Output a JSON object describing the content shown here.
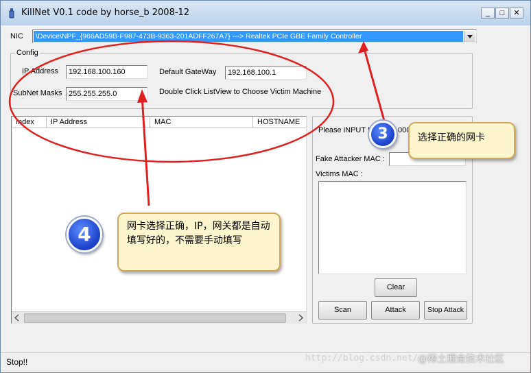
{
  "window": {
    "title": "KillNet  V0.1 code by horse_b 2008-12",
    "minimize_glyph": "_",
    "maximize_glyph": "□",
    "close_glyph": "✕"
  },
  "nic": {
    "label": "NIC",
    "selected": "\\Device\\NPF_{966AD59B-F987-473B-9363-201ADFF267A7}  --->  Realtek PCIe GBE Family Controller"
  },
  "config": {
    "title": "Config",
    "ip_label": "IP Address",
    "ip_value": "192.168.100.160",
    "gateway_label": "Default GateWay",
    "gateway_value": "192.168.100.1",
    "mask_label": "SubNet Masks",
    "mask_value": "255.255.255.0",
    "hint": "Double Click ListView to Choose Victim Machine"
  },
  "listview": {
    "columns": [
      "Index",
      "IP Address",
      "MAC",
      "HOSTNAME"
    ]
  },
  "right_panel": {
    "please_input": "Please iNPUT M",
    "please_input_tail": "000",
    "fake_mac_label": "Fake Attacker MAC :",
    "victims_mac_label": "Victims MAC :",
    "clear": "Clear",
    "scan": "Scan",
    "attack": "Attack",
    "stop_attack": "Stop Attack"
  },
  "status": "Stop!!",
  "annotations": {
    "badge3": "3",
    "callout3": "选择正确的网卡",
    "badge4": "4",
    "callout4": "网卡选择正确，IP，网关都是自动填写好的，不需要手动填写"
  },
  "watermark": "http://blog.csdn.net/",
  "watermark2": "@稀土掘金技术社区",
  "colors": {
    "selection": "#3399ff",
    "annotation_red": "#e02020",
    "callout_bg": "#fdf6cc"
  },
  "icons": {
    "app": "bottle-icon",
    "dropdown": "chevron-down-icon",
    "scroll_left": "arrow-left-icon",
    "scroll_right": "arrow-right-icon"
  }
}
